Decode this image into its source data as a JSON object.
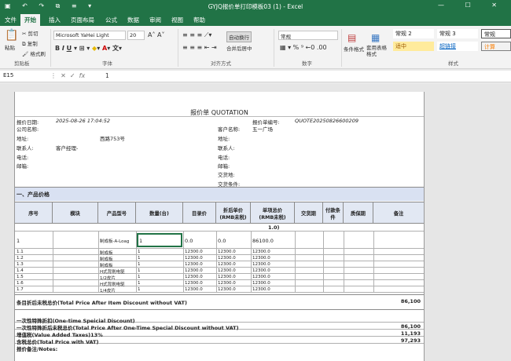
{
  "app": {
    "quick_access": "▣ ↶ ↷ ⧉ ≡ ▾",
    "window_title": "GYJQ报价单打印模板03 (1) - Excel",
    "window_controls": "— ☐ ✕"
  },
  "tabs": [
    "文件",
    "开始",
    "插入",
    "页面布局",
    "公式",
    "数据",
    "审阅",
    "视图",
    "帮助"
  ],
  "active_tab": "开始",
  "ribbon": {
    "paste": "粘贴",
    "cut": "剪切",
    "copy": "复制",
    "format_painter": "格式刷",
    "clipboard": "剪贴板",
    "font_name": "Microsoft YaHei Light",
    "font_size": "20",
    "font_group": "字体",
    "wrap": "自动换行",
    "merge": "合并后居中",
    "align_group": "对齐方式",
    "number_format": "常规",
    "number_group": "数字",
    "cond_format": "条件格式",
    "table_format": "套用表格格式",
    "styles_group": "样式",
    "style_normal2": "常规 2",
    "style_normal3": "常规 3",
    "style_normal": "常规",
    "style_good": "适中",
    "style_link": "超链接",
    "style_calc": "计算"
  },
  "formula_bar": {
    "name_box": "E15",
    "fx": "fx",
    "value": "1"
  },
  "doc": {
    "title": "报价单 QUOTATION",
    "date_label": "报价日期:",
    "date_value": "2025-08-26 17:04:52",
    "quote_no_label": "报价单编号:",
    "quote_no_value": "QUOTE20250826600209",
    "company_label": "公司名称:",
    "address_label": "地址:",
    "address_value": "西路753号",
    "contact_label": "联系人:",
    "contact_value": "客户经理-",
    "phone_label": "电话:",
    "email_label": "邮箱:",
    "cust_label": "客户名称:",
    "cust_value": "五一广场",
    "cust_address": "地址:",
    "cust_contact": "联系人:",
    "cust_phone": "电话:",
    "cust_email": "邮箱:",
    "delivery_addr": "交货地:",
    "delivery_terms": "交货条件:",
    "section1": "一、产品价格",
    "headers": [
      "序号",
      "模块",
      "产品型号",
      "数量(台)",
      "目录价",
      "折后单价\n(RMB未税)",
      "单项总价\n(RMB未税)",
      "交货期",
      "付款条件",
      "质保期",
      "备注"
    ],
    "group_row": "1.0)",
    "main_row": {
      "no": "1",
      "model": "制成板-A-Loag",
      "qty": "1",
      "list": "0.0",
      "unit": "0.0",
      "total": "86100.0"
    },
    "sub_rows": [
      {
        "no": "1.1",
        "model": "制成板",
        "qty": "1",
        "list": "12300.0",
        "unit": "12300.0",
        "total": "12300.0"
      },
      {
        "no": "1.2",
        "model": "制成板",
        "qty": "1",
        "list": "12300.0",
        "unit": "12300.0",
        "total": "12300.0"
      },
      {
        "no": "1.3",
        "model": "制成板",
        "qty": "1",
        "list": "12300.0",
        "unit": "12300.0",
        "total": "12300.0"
      },
      {
        "no": "1.4",
        "model": "H式背刷电驱",
        "qty": "1",
        "list": "12300.0",
        "unit": "12300.0",
        "total": "12300.0"
      },
      {
        "no": "1.5",
        "model": "1/2皮片",
        "qty": "1",
        "list": "12300.0",
        "unit": "12300.0",
        "total": "12300.0"
      },
      {
        "no": "1.6",
        "model": "H式背刷电驱",
        "qty": "1",
        "list": "12300.0",
        "unit": "12300.0",
        "total": "12300.0"
      },
      {
        "no": "1.7",
        "model": "1/4皮片",
        "qty": "1",
        "list": "12300.0",
        "unit": "12300.0",
        "total": "12300.0"
      }
    ],
    "sum1_label": "条目折后未税总价(Total Price After Item Discount without VAT)",
    "sum1_value": "86,100",
    "sum2_label": "一次性特殊折扣(One-time Speicial Discount)",
    "sum3_label": "一次性特殊折后未税总价(Total Price After One-Time Special Discount without VAT)",
    "sum3_value": "86,100",
    "sum4_label": "增值税(Value Added Taxes)13%",
    "sum4_value": "11,193",
    "sum5_label": "含税总价(Total Price with VAT)",
    "sum5_value": "97,293",
    "notes_label": "报价备注/Notes:"
  }
}
